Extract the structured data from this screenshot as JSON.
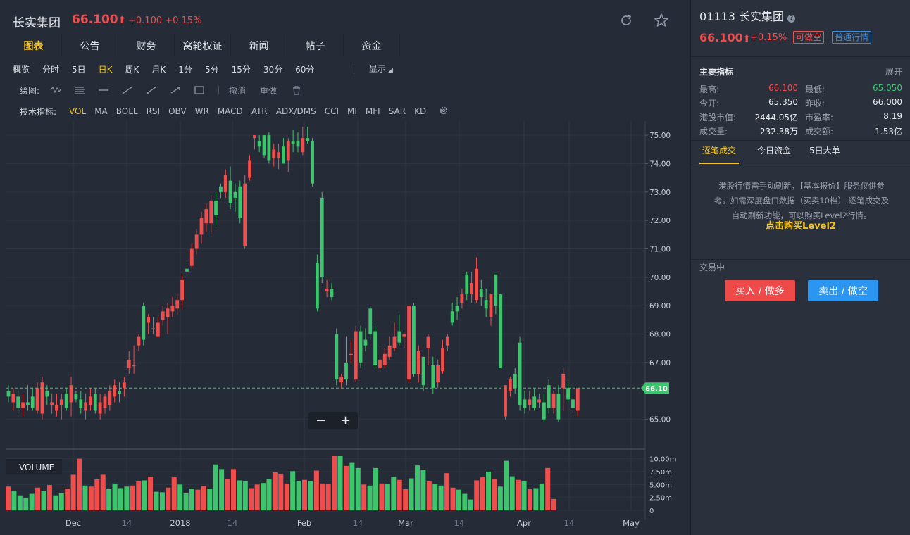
{
  "header": {
    "name": "长实集团",
    "price": "66.100",
    "change": "+0.100 +0.15%"
  },
  "tabs": [
    "图表",
    "公告",
    "财务",
    "窝轮权证",
    "新闻",
    "帖子",
    "资金"
  ],
  "periods": [
    "概览",
    "分时",
    "5日",
    "日K",
    "周K",
    "月K",
    "1分",
    "5分",
    "15分",
    "30分",
    "60分"
  ],
  "display_label": "显示",
  "draw": {
    "label": "绘图:",
    "undo": "撤消",
    "redo": "重做"
  },
  "indicators": {
    "label": "技术指标:",
    "items": [
      "VOL",
      "MA",
      "BOLL",
      "RSI",
      "OBV",
      "WR",
      "MACD",
      "ATR",
      "ADX/DMS",
      "CCI",
      "MI",
      "MFI",
      "SAR",
      "KD"
    ]
  },
  "right": {
    "code_title": "01113 长实集团",
    "price": "66.100",
    "change": "+0.15%",
    "badge_short": "可做空",
    "badge_quote": "普通行情",
    "main_indicators": "主要指标",
    "expand": "展开",
    "stats": [
      {
        "label": "最高:",
        "value": "66.100",
        "color": "#f04d4d"
      },
      {
        "label": "最低:",
        "value": "65.050",
        "color": "#3ec46d"
      },
      {
        "label": "今开:",
        "value": "65.350",
        "color": "#e8eaef"
      },
      {
        "label": "昨收:",
        "value": "66.000",
        "color": "#e8eaef"
      },
      {
        "label": "港股市值:",
        "value": "2444.05亿",
        "color": "#e8eaef"
      },
      {
        "label": "市盈率:",
        "value": "8.19",
        "color": "#e8eaef"
      },
      {
        "label": "成交量:",
        "value": "232.38万",
        "color": "#e8eaef"
      },
      {
        "label": "成交额:",
        "value": "1.53亿",
        "color": "#e8eaef"
      }
    ],
    "tabs": [
      "逐笔成交",
      "今日资金",
      "5日大单"
    ],
    "notice": "港股行情需手动刷新，【基本报价】服务仅供参考。如需深度盘口数据（买卖10档）,逐笔成交及自动刷新功能，可以购买Level2行情。",
    "notice_link": "点击购买Level2",
    "trading": "交易中",
    "buy": "买入 / 做多",
    "sell": "卖出 / 做空"
  },
  "chart_data": {
    "type": "candlestick",
    "price_ticks": [
      "75.00",
      "74.00",
      "73.00",
      "72.00",
      "71.00",
      "70.00",
      "69.00",
      "68.00",
      "67.00",
      "65.00"
    ],
    "price_range": [
      64.0,
      75.3
    ],
    "current_price_label": "66.10",
    "volume_label": "VOLUME",
    "volume_ticks": [
      "10.00m",
      "7.50m",
      "5.00m",
      "2.50m",
      "0"
    ],
    "volume_range": [
      0,
      10.5
    ],
    "x_labels": [
      "Dec",
      "14",
      "2018",
      "14",
      "Feb",
      "14",
      "Mar",
      "14",
      "Apr",
      "14",
      "May"
    ],
    "up_color": "#f04d4d",
    "down_color": "#3ec46d",
    "candles": [
      {
        "o": 66.0,
        "h": 66.2,
        "l": 65.6,
        "c": 65.8
      },
      {
        "o": 65.6,
        "h": 66.1,
        "l": 65.3,
        "c": 65.9
      },
      {
        "o": 65.8,
        "h": 66.0,
        "l": 65.2,
        "c": 65.4
      },
      {
        "o": 65.4,
        "h": 65.9,
        "l": 65.1,
        "c": 65.6
      },
      {
        "o": 65.6,
        "h": 66.2,
        "l": 65.3,
        "c": 65.5
      },
      {
        "o": 65.8,
        "h": 66.1,
        "l": 65.3,
        "c": 65.4
      },
      {
        "o": 65.3,
        "h": 66.3,
        "l": 65.2,
        "c": 66.1
      },
      {
        "o": 65.2,
        "h": 66.5,
        "l": 65.0,
        "c": 66.3
      },
      {
        "o": 66.0,
        "h": 66.2,
        "l": 65.5,
        "c": 65.8
      },
      {
        "o": 65.5,
        "h": 65.9,
        "l": 65.2,
        "c": 65.6
      },
      {
        "o": 65.3,
        "h": 65.9,
        "l": 65.1,
        "c": 65.5
      },
      {
        "o": 65.5,
        "h": 65.9,
        "l": 65.0,
        "c": 65.7
      },
      {
        "o": 65.9,
        "h": 66.1,
        "l": 65.3,
        "c": 65.4
      },
      {
        "o": 65.6,
        "h": 66.5,
        "l": 65.1,
        "c": 66.2
      },
      {
        "o": 65.9,
        "h": 66.0,
        "l": 65.6,
        "c": 65.7
      },
      {
        "o": 65.7,
        "h": 66.0,
        "l": 65.2,
        "c": 65.4
      },
      {
        "o": 65.3,
        "h": 65.9,
        "l": 65.0,
        "c": 65.6
      },
      {
        "o": 65.5,
        "h": 66.1,
        "l": 65.3,
        "c": 65.8
      },
      {
        "o": 65.9,
        "h": 66.1,
        "l": 65.2,
        "c": 65.3
      },
      {
        "o": 65.2,
        "h": 65.9,
        "l": 65.0,
        "c": 65.6
      },
      {
        "o": 65.4,
        "h": 65.9,
        "l": 65.2,
        "c": 65.8
      },
      {
        "o": 65.5,
        "h": 66.2,
        "l": 65.3,
        "c": 66.0
      },
      {
        "o": 65.8,
        "h": 66.4,
        "l": 65.6,
        "c": 66.2
      },
      {
        "o": 66.0,
        "h": 66.3,
        "l": 65.6,
        "c": 65.9
      },
      {
        "o": 66.1,
        "h": 66.5,
        "l": 65.8,
        "c": 66.3
      },
      {
        "o": 66.8,
        "h": 67.4,
        "l": 66.6,
        "c": 67.1
      },
      {
        "o": 66.9,
        "h": 67.6,
        "l": 66.6,
        "c": 66.9
      },
      {
        "o": 67.6,
        "h": 68.0,
        "l": 67.4,
        "c": 67.9
      },
      {
        "o": 69.0,
        "h": 69.1,
        "l": 67.6,
        "c": 67.8
      },
      {
        "o": 68.4,
        "h": 68.7,
        "l": 68.0,
        "c": 68.6
      },
      {
        "o": 68.2,
        "h": 68.6,
        "l": 68.0,
        "c": 68.2
      },
      {
        "o": 67.9,
        "h": 68.6,
        "l": 67.9,
        "c": 68.4
      },
      {
        "o": 68.5,
        "h": 69.0,
        "l": 68.3,
        "c": 68.8
      },
      {
        "o": 68.6,
        "h": 69.1,
        "l": 68.0,
        "c": 68.9
      },
      {
        "o": 68.8,
        "h": 69.3,
        "l": 68.6,
        "c": 69.0
      },
      {
        "o": 68.9,
        "h": 69.4,
        "l": 68.7,
        "c": 69.2
      },
      {
        "o": 69.2,
        "h": 70.1,
        "l": 68.9,
        "c": 69.9
      },
      {
        "o": 70.3,
        "h": 70.5,
        "l": 70.1,
        "c": 70.2
      },
      {
        "o": 70.4,
        "h": 71.2,
        "l": 70.3,
        "c": 71.0
      },
      {
        "o": 71.0,
        "h": 71.7,
        "l": 70.8,
        "c": 71.5
      },
      {
        "o": 71.5,
        "h": 72.3,
        "l": 71.2,
        "c": 72.1
      },
      {
        "o": 71.9,
        "h": 72.6,
        "l": 71.6,
        "c": 72.4
      },
      {
        "o": 71.9,
        "h": 72.9,
        "l": 71.5,
        "c": 72.7
      },
      {
        "o": 72.7,
        "h": 73.0,
        "l": 71.8,
        "c": 72.2
      },
      {
        "o": 73.2,
        "h": 73.3,
        "l": 72.8,
        "c": 73.0
      },
      {
        "o": 73.0,
        "h": 73.8,
        "l": 72.8,
        "c": 73.6
      },
      {
        "o": 73.4,
        "h": 73.9,
        "l": 72.4,
        "c": 72.6
      },
      {
        "o": 73.0,
        "h": 73.3,
        "l": 72.3,
        "c": 72.8
      },
      {
        "o": 73.2,
        "h": 73.4,
        "l": 71.9,
        "c": 72.1
      },
      {
        "o": 71.1,
        "h": 73.6,
        "l": 71.0,
        "c": 73.3
      },
      {
        "o": 73.5,
        "h": 74.3,
        "l": 73.4,
        "c": 74.1
      },
      {
        "o": 74.9,
        "h": 75.0,
        "l": 74.5,
        "c": 75.0
      },
      {
        "o": 74.8,
        "h": 75.0,
        "l": 74.4,
        "c": 74.6
      },
      {
        "o": 75.0,
        "h": 75.0,
        "l": 74.2,
        "c": 74.3
      },
      {
        "o": 75.0,
        "h": 75.1,
        "l": 74.0,
        "c": 74.1
      },
      {
        "o": 74.2,
        "h": 74.7,
        "l": 73.9,
        "c": 74.5
      },
      {
        "o": 74.2,
        "h": 74.7,
        "l": 73.8,
        "c": 74.4
      },
      {
        "o": 74.6,
        "h": 74.9,
        "l": 74.0,
        "c": 74.0
      },
      {
        "o": 74.1,
        "h": 74.9,
        "l": 73.7,
        "c": 74.8
      },
      {
        "o": 74.8,
        "h": 75.2,
        "l": 74.4,
        "c": 74.7
      },
      {
        "o": 74.8,
        "h": 75.1,
        "l": 74.4,
        "c": 74.6
      },
      {
        "o": 74.4,
        "h": 75.3,
        "l": 74.3,
        "c": 74.9
      },
      {
        "o": 74.9,
        "h": 75.3,
        "l": 74.7,
        "c": 74.8
      },
      {
        "o": 74.8,
        "h": 74.9,
        "l": 73.2,
        "c": 73.3
      },
      {
        "o": 70.5,
        "h": 70.8,
        "l": 68.8,
        "c": 68.9
      },
      {
        "o": 72.8,
        "h": 73.0,
        "l": 69.8,
        "c": 70.0
      },
      {
        "o": 69.5,
        "h": 69.9,
        "l": 69.3,
        "c": 69.6
      },
      {
        "o": 69.6,
        "h": 69.8,
        "l": 69.2,
        "c": 69.3
      },
      {
        "o": 68.0,
        "h": 68.2,
        "l": 66.2,
        "c": 66.4
      },
      {
        "o": 66.3,
        "h": 66.6,
        "l": 66.1,
        "c": 66.5
      },
      {
        "o": 67.0,
        "h": 67.9,
        "l": 66.2,
        "c": 66.4
      },
      {
        "o": 67.3,
        "h": 67.8,
        "l": 67.0,
        "c": 67.3
      },
      {
        "o": 66.4,
        "h": 68.3,
        "l": 66.3,
        "c": 68.1
      },
      {
        "o": 68.1,
        "h": 68.3,
        "l": 66.8,
        "c": 67.0
      },
      {
        "o": 67.8,
        "h": 68.2,
        "l": 67.4,
        "c": 67.6
      },
      {
        "o": 68.9,
        "h": 69.0,
        "l": 67.8,
        "c": 68.0
      },
      {
        "o": 68.1,
        "h": 68.3,
        "l": 66.8,
        "c": 66.9
      },
      {
        "o": 66.8,
        "h": 67.5,
        "l": 66.7,
        "c": 67.1
      },
      {
        "o": 66.9,
        "h": 67.5,
        "l": 66.8,
        "c": 67.3
      },
      {
        "o": 67.2,
        "h": 67.9,
        "l": 67.1,
        "c": 67.6
      },
      {
        "o": 67.5,
        "h": 68.4,
        "l": 67.4,
        "c": 67.9
      },
      {
        "o": 68.1,
        "h": 68.7,
        "l": 67.6,
        "c": 67.7
      },
      {
        "o": 67.9,
        "h": 68.1,
        "l": 67.5,
        "c": 68.0
      },
      {
        "o": 66.4,
        "h": 69.0,
        "l": 66.3,
        "c": 69.0
      },
      {
        "o": 69.0,
        "h": 69.1,
        "l": 66.5,
        "c": 66.6
      },
      {
        "o": 66.6,
        "h": 67.6,
        "l": 66.3,
        "c": 67.4
      },
      {
        "o": 67.2,
        "h": 67.2,
        "l": 66.0,
        "c": 66.2
      },
      {
        "o": 67.5,
        "h": 68.0,
        "l": 66.9,
        "c": 67.9
      },
      {
        "o": 66.9,
        "h": 67.2,
        "l": 65.9,
        "c": 66.1
      },
      {
        "o": 66.3,
        "h": 67.1,
        "l": 66.1,
        "c": 66.9
      },
      {
        "o": 66.7,
        "h": 67.8,
        "l": 66.6,
        "c": 67.5
      },
      {
        "o": 67.6,
        "h": 68.0,
        "l": 67.4,
        "c": 67.9
      },
      {
        "o": 68.8,
        "h": 69.1,
        "l": 68.3,
        "c": 68.4
      },
      {
        "o": 69.0,
        "h": 69.3,
        "l": 68.5,
        "c": 68.8
      },
      {
        "o": 69.1,
        "h": 69.6,
        "l": 68.9,
        "c": 69.4
      },
      {
        "o": 70.1,
        "h": 70.2,
        "l": 69.2,
        "c": 69.4
      },
      {
        "o": 69.4,
        "h": 70.2,
        "l": 69.1,
        "c": 69.8
      },
      {
        "o": 69.2,
        "h": 70.7,
        "l": 69.1,
        "c": 70.3
      },
      {
        "o": 69.6,
        "h": 69.9,
        "l": 69.0,
        "c": 69.3
      },
      {
        "o": 69.2,
        "h": 69.6,
        "l": 68.6,
        "c": 68.9
      },
      {
        "o": 68.6,
        "h": 68.9,
        "l": 68.3,
        "c": 69.4
      },
      {
        "o": 70.1,
        "h": 70.1,
        "l": 68.7,
        "c": 69.0
      },
      {
        "o": 69.4,
        "h": 69.4,
        "l": 66.8,
        "c": 66.8
      },
      {
        "o": 65.1,
        "h": 66.2,
        "l": 65.0,
        "c": 66.2
      },
      {
        "o": 66.0,
        "h": 66.5,
        "l": 65.8,
        "c": 66.4
      },
      {
        "o": 66.6,
        "h": 66.8,
        "l": 65.9,
        "c": 66.1
      },
      {
        "o": 67.7,
        "h": 67.9,
        "l": 65.3,
        "c": 65.5
      },
      {
        "o": 65.7,
        "h": 66.0,
        "l": 65.2,
        "c": 65.4
      },
      {
        "o": 65.5,
        "h": 66.0,
        "l": 65.3,
        "c": 65.7
      },
      {
        "o": 65.8,
        "h": 66.1,
        "l": 65.3,
        "c": 65.4
      },
      {
        "o": 65.6,
        "h": 65.9,
        "l": 65.4,
        "c": 65.7
      },
      {
        "o": 65.6,
        "h": 65.9,
        "l": 64.9,
        "c": 65.0
      },
      {
        "o": 66.2,
        "h": 66.4,
        "l": 65.2,
        "c": 65.4
      },
      {
        "o": 65.4,
        "h": 66.0,
        "l": 65.2,
        "c": 65.9
      },
      {
        "o": 65.9,
        "h": 66.2,
        "l": 64.9,
        "c": 65.0
      },
      {
        "o": 66.1,
        "h": 66.8,
        "l": 65.3,
        "c": 66.6
      },
      {
        "o": 66.1,
        "h": 66.3,
        "l": 65.6,
        "c": 65.7
      },
      {
        "o": 65.7,
        "h": 66.2,
        "l": 65.2,
        "c": 65.4
      },
      {
        "o": 65.3,
        "h": 66.1,
        "l": 65.1,
        "c": 66.1
      }
    ],
    "volumes": [
      {
        "v": 4.6,
        "up": true
      },
      {
        "v": 3.8,
        "up": false
      },
      {
        "v": 2.9,
        "up": false
      },
      {
        "v": 2.4,
        "up": false
      },
      {
        "v": 3.2,
        "up": false
      },
      {
        "v": 4.4,
        "up": true
      },
      {
        "v": 3.8,
        "up": false
      },
      {
        "v": 4.9,
        "up": true
      },
      {
        "v": 2.9,
        "up": false
      },
      {
        "v": 3.3,
        "up": false
      },
      {
        "v": 4.2,
        "up": true
      },
      {
        "v": 6.9,
        "up": true
      },
      {
        "v": 10.0,
        "up": true
      },
      {
        "v": 4.8,
        "up": false
      },
      {
        "v": 4.6,
        "up": true
      },
      {
        "v": 6.0,
        "up": true
      },
      {
        "v": 6.9,
        "up": true
      },
      {
        "v": 4.1,
        "up": false
      },
      {
        "v": 5.2,
        "up": false
      },
      {
        "v": 4.3,
        "up": false
      },
      {
        "v": 4.6,
        "up": false
      },
      {
        "v": 4.8,
        "up": true
      },
      {
        "v": 5.6,
        "up": true
      },
      {
        "v": 5.8,
        "up": false
      },
      {
        "v": 6.5,
        "up": true
      },
      {
        "v": 3.6,
        "up": false
      },
      {
        "v": 3.5,
        "up": false
      },
      {
        "v": 4.4,
        "up": true
      },
      {
        "v": 6.4,
        "up": true
      },
      {
        "v": 5.0,
        "up": false
      },
      {
        "v": 3.3,
        "up": false
      },
      {
        "v": 4.2,
        "up": false
      },
      {
        "v": 4.0,
        "up": true
      },
      {
        "v": 4.7,
        "up": true
      },
      {
        "v": 4.2,
        "up": false
      },
      {
        "v": 8.9,
        "up": false
      },
      {
        "v": 8.0,
        "up": false
      },
      {
        "v": 6.1,
        "up": true
      },
      {
        "v": 8.0,
        "up": true
      },
      {
        "v": 5.8,
        "up": false
      },
      {
        "v": 5.6,
        "up": false
      },
      {
        "v": 4.3,
        "up": true
      },
      {
        "v": 5.0,
        "up": true
      },
      {
        "v": 5.3,
        "up": false
      },
      {
        "v": 6.1,
        "up": false
      },
      {
        "v": 7.4,
        "up": true
      },
      {
        "v": 7.1,
        "up": true
      },
      {
        "v": 5.2,
        "up": true
      },
      {
        "v": 7.6,
        "up": false
      },
      {
        "v": 5.7,
        "up": false
      },
      {
        "v": 5.9,
        "up": true
      },
      {
        "v": 5.7,
        "up": false
      },
      {
        "v": 7.7,
        "up": true
      },
      {
        "v": 5.2,
        "up": true
      },
      {
        "v": 5.1,
        "up": true
      },
      {
        "v": 11.7,
        "up": true
      },
      {
        "v": 11.4,
        "up": false
      },
      {
        "v": 8.6,
        "up": true
      },
      {
        "v": 9.2,
        "up": false
      },
      {
        "v": 8.2,
        "up": false
      },
      {
        "v": 5.0,
        "up": true
      },
      {
        "v": 4.8,
        "up": false
      },
      {
        "v": 8.2,
        "up": false
      },
      {
        "v": 5.2,
        "up": true
      },
      {
        "v": 5.1,
        "up": false
      },
      {
        "v": 6.5,
        "up": false
      },
      {
        "v": 5.9,
        "up": true
      },
      {
        "v": 4.1,
        "up": true
      },
      {
        "v": 6.2,
        "up": false
      },
      {
        "v": 8.7,
        "up": false
      },
      {
        "v": 7.9,
        "up": false
      },
      {
        "v": 5.6,
        "up": true
      },
      {
        "v": 5.1,
        "up": false
      },
      {
        "v": 4.8,
        "up": false
      },
      {
        "v": 7.2,
        "up": true
      },
      {
        "v": 4.4,
        "up": true
      },
      {
        "v": 4.0,
        "up": false
      },
      {
        "v": 3.2,
        "up": false
      },
      {
        "v": 2.1,
        "up": false
      },
      {
        "v": 5.8,
        "up": true
      },
      {
        "v": 6.4,
        "up": true
      },
      {
        "v": 7.5,
        "up": false
      },
      {
        "v": 6.1,
        "up": true
      },
      {
        "v": 4.6,
        "up": false
      },
      {
        "v": 9.6,
        "up": false
      },
      {
        "v": 6.6,
        "up": false
      },
      {
        "v": 5.9,
        "up": true
      },
      {
        "v": 5.6,
        "up": false
      },
      {
        "v": 4.1,
        "up": true
      },
      {
        "v": 4.3,
        "up": false
      },
      {
        "v": 5.2,
        "up": false
      },
      {
        "v": 8.2,
        "up": true
      },
      {
        "v": 2.2,
        "up": true
      }
    ]
  }
}
